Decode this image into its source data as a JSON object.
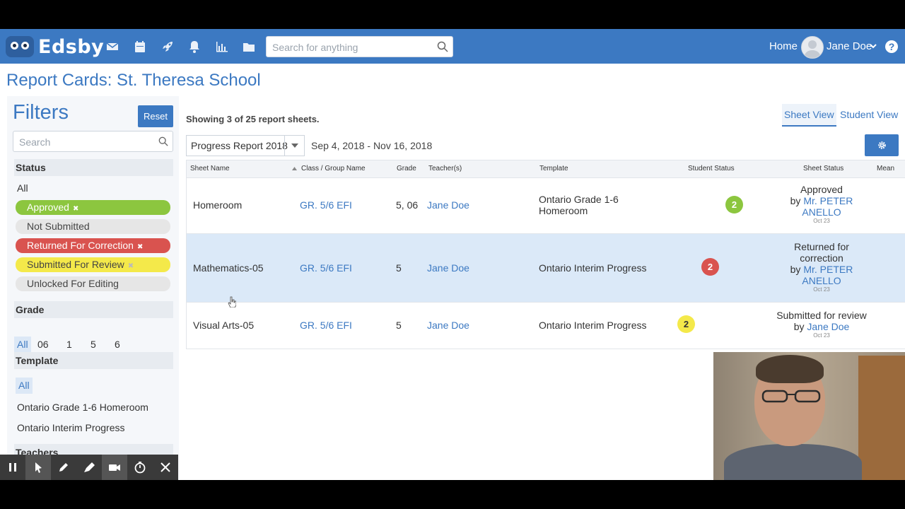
{
  "header": {
    "brand": "Edsby",
    "nav_icons": [
      "mail-icon",
      "calendar-icon",
      "rocket-icon",
      "bell-icon",
      "chart-icon",
      "folder-icon"
    ],
    "search_placeholder": "Search for anything",
    "home_label": "Home",
    "user_name": "Jane Doe",
    "accent_color": "#3c79c2"
  },
  "page": {
    "title": "Report Cards: St. Theresa School"
  },
  "filters": {
    "title": "Filters",
    "reset_label": "Reset",
    "search_placeholder": "Search",
    "status": {
      "heading": "Status",
      "all_label": "All",
      "options": [
        {
          "label": "Approved",
          "selected": true,
          "color": "#8cc63f"
        },
        {
          "label": "Not Submitted",
          "selected": false,
          "color": "#e6e6e6"
        },
        {
          "label": "Returned For Correction",
          "selected": true,
          "color": "#d9534f"
        },
        {
          "label": "Submitted For Review",
          "selected": true,
          "color": "#f4e94a"
        },
        {
          "label": "Unlocked For Editing",
          "selected": false,
          "color": "#e6e6e6"
        }
      ]
    },
    "grade": {
      "heading": "Grade",
      "options": [
        "All",
        "06",
        "1",
        "5",
        "6"
      ],
      "selected": "All"
    },
    "template": {
      "heading": "Template",
      "options": [
        "All",
        "Ontario Grade 1-6 Homeroom",
        "Ontario Interim Progress"
      ],
      "selected": "All"
    },
    "teachers": {
      "heading": "Teachers"
    }
  },
  "main": {
    "showing_text": "Showing 3 of 25 report sheets.",
    "report_select": "Progress Report 2018",
    "date_range": "Sep 4, 2018 - Nov 16, 2018",
    "views": [
      "Sheet View",
      "Student View"
    ],
    "active_view": "Sheet View",
    "columns": [
      "Sheet Name",
      "Class / Group Name",
      "Grade",
      "Teacher(s)",
      "Template",
      "Student Status",
      "Sheet Status",
      "Mean"
    ],
    "rows": [
      {
        "sheet_name": "Homeroom",
        "class_group": "GR. 5/6 EFI",
        "grade": "5, 06",
        "teacher": "Jane Doe",
        "template": "Ontario Grade 1-6 Homeroom",
        "student_status_count": "2",
        "student_status_color": "#8cc63f",
        "sheet_status_text": "Approved",
        "sheet_status_by": "by",
        "sheet_status_person": "Mr. PETER ANELLO",
        "sheet_status_date": "Oct 23"
      },
      {
        "sheet_name": "Mathematics-05",
        "class_group": "GR. 5/6 EFI",
        "grade": "5",
        "teacher": "Jane Doe",
        "template": "Ontario Interim Progress",
        "student_status_count": "2",
        "student_status_color": "#d9534f",
        "sheet_status_text": "Returned for correction",
        "sheet_status_by": "by",
        "sheet_status_person": "Mr. PETER ANELLO",
        "sheet_status_date": "Oct 23"
      },
      {
        "sheet_name": "Visual Arts-05",
        "class_group": "GR. 5/6 EFI",
        "grade": "5",
        "teacher": "Jane Doe",
        "template": "Ontario Interim Progress",
        "student_status_count": "2",
        "student_status_color": "#f4e94a",
        "sheet_status_text": "Submitted for review",
        "sheet_status_by": "by",
        "sheet_status_person": "Jane Doe",
        "sheet_status_date": "Oct 23"
      }
    ]
  },
  "recorder_toolbar": {
    "buttons": [
      "pause-icon",
      "pointer-icon",
      "pen-icon",
      "highlighter-icon",
      "camera-icon",
      "timer-icon",
      "close-icon"
    ]
  }
}
